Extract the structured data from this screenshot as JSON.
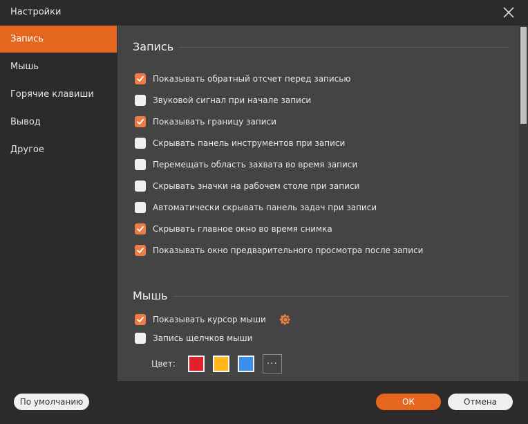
{
  "window": {
    "title": "Настройки"
  },
  "sidebar": {
    "items": [
      {
        "label": "Запись",
        "active": true
      },
      {
        "label": "Мышь",
        "active": false
      },
      {
        "label": "Горячие клавиши",
        "active": false
      },
      {
        "label": "Вывод",
        "active": false
      },
      {
        "label": "Другое",
        "active": false
      }
    ]
  },
  "recording": {
    "title": "Запись",
    "options": [
      {
        "label": "Показывать обратный отсчет перед записью",
        "checked": true
      },
      {
        "label": "Звуковой сигнал при начале записи",
        "checked": false
      },
      {
        "label": "Показывать границу записи",
        "checked": true
      },
      {
        "label": "Скрывать панель инструментов при записи",
        "checked": false
      },
      {
        "label": "Перемещать область захвата во время записи",
        "checked": false
      },
      {
        "label": "Скрывать значки на рабочем столе при записи",
        "checked": false
      },
      {
        "label": "Автоматически скрывать панель задач при записи",
        "checked": false
      },
      {
        "label": "Скрывать главное окно во время снимка",
        "checked": true
      },
      {
        "label": "Показывать окно предварительного просмотра после записи",
        "checked": true
      }
    ]
  },
  "mouse": {
    "title": "Мышь",
    "options": [
      {
        "label": "Показывать курсор мыши",
        "checked": true
      },
      {
        "label": "Запись щелчков мыши",
        "checked": false
      }
    ],
    "color_label": "Цвет:",
    "colors": [
      "#e0212d",
      "#ffb818",
      "#3b8ee8"
    ],
    "selected_color": "#ffb818",
    "more_label": "···"
  },
  "footer": {
    "default_label": "По умолчанию",
    "ok_label": "ОК",
    "cancel_label": "Отмена"
  },
  "theme": {
    "accent": "#e5661f",
    "checkbox_checked": "#ee7d45",
    "content_bg": "#444444",
    "frame_bg": "#2b2b2b"
  }
}
